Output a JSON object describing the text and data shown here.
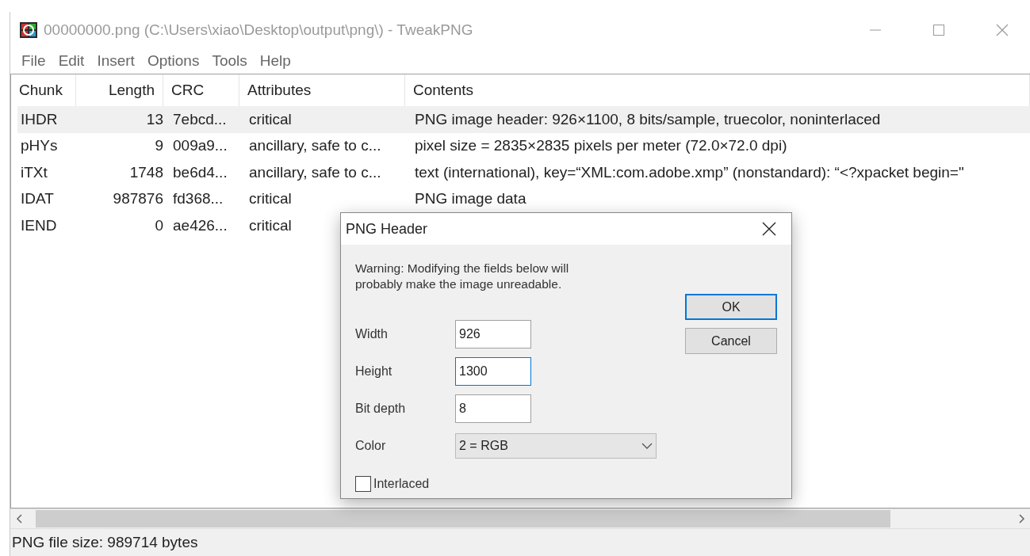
{
  "window": {
    "title": "00000000.png (C:\\Users\\xiao\\Desktop\\output\\png\\) - TweakPNG"
  },
  "menu": [
    "File",
    "Edit",
    "Insert",
    "Options",
    "Tools",
    "Help"
  ],
  "table": {
    "columns": [
      "Chunk",
      "Length",
      "CRC",
      "Attributes",
      "Contents"
    ],
    "rows": [
      {
        "selected": true,
        "cells": [
          "IHDR",
          "13",
          "7ebcd...",
          "critical",
          "PNG image header: 926×1100, 8 bits/sample, truecolor, noninterlaced"
        ]
      },
      {
        "selected": false,
        "cells": [
          "pHYs",
          "9",
          "009a9...",
          "ancillary, safe to c...",
          "pixel size = 2835×2835 pixels per meter (72.0×72.0 dpi)"
        ]
      },
      {
        "selected": false,
        "cells": [
          "iTXt",
          "1748",
          "be6d4...",
          "ancillary, safe to c...",
          "text (international), key=“XML:com.adobe.xmp” (nonstandard): “<?xpacket begin=\""
        ]
      },
      {
        "selected": false,
        "cells": [
          "IDAT",
          "987876",
          "fd368...",
          "critical",
          "PNG image data"
        ]
      },
      {
        "selected": false,
        "cells": [
          "IEND",
          "0",
          "ae426...",
          "critical"
        ]
      }
    ]
  },
  "dialog": {
    "title": "PNG Header",
    "warning": "Warning: Modifying the fields below will probably make the image unreadable.",
    "fields": [
      {
        "label": "Width",
        "value": "926",
        "focused": false
      },
      {
        "label": "Height",
        "value": "1300",
        "focused": true
      },
      {
        "label": "Bit depth",
        "value": "8",
        "focused": false
      }
    ],
    "color": {
      "label": "Color",
      "value": "2 = RGB"
    },
    "interlaced": {
      "label": "Interlaced",
      "checked": false
    },
    "buttons": [
      {
        "label": "OK",
        "default": true
      },
      {
        "label": "Cancel",
        "default": false
      }
    ]
  },
  "status_bar": "PNG file size: 989714 bytes"
}
